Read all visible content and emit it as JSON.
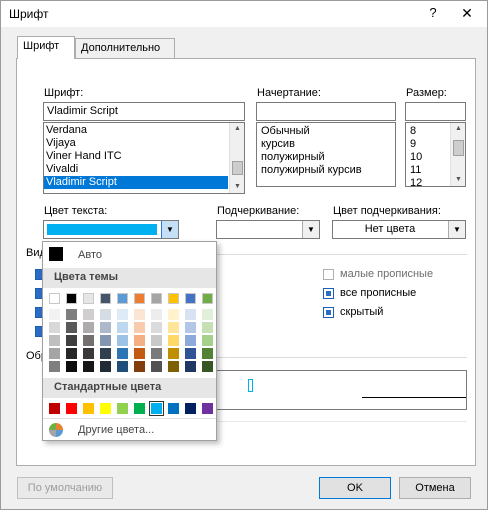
{
  "window": {
    "title": "Шрифт",
    "help": "?",
    "close": "✕"
  },
  "tabs": [
    {
      "label": "Шрифт",
      "active": true
    },
    {
      "label": "Дополнительно",
      "active": false
    }
  ],
  "font": {
    "label": "Шрифт:",
    "value": "Vladimir Script",
    "items": [
      "Verdana",
      "Vijaya",
      "Viner Hand ITC",
      "Vivaldi",
      "Vladimir Script"
    ],
    "selected_index": 4
  },
  "style": {
    "label": "Начертание:",
    "value": "",
    "items": [
      "Обычный",
      "курсив",
      "полужирный",
      "полужирный курсив"
    ]
  },
  "size": {
    "label": "Размер:",
    "value": "",
    "items": [
      "8",
      "9",
      "10",
      "11",
      "12"
    ]
  },
  "text_color": {
    "label": "Цвет текста:",
    "swatch": "#00b0f0"
  },
  "underline": {
    "label": "Подчеркивание:",
    "value": ""
  },
  "underline_color": {
    "label": "Цвет подчеркивания:",
    "value": "Нет цвета"
  },
  "effects": {
    "group_label": "Видоизменение",
    "items": [
      {
        "label": "малые прописные",
        "checked": false,
        "enabled": false
      },
      {
        "label": "все прописные",
        "checked": true,
        "enabled": true
      },
      {
        "label": "скрытый",
        "checked": true,
        "enabled": true
      }
    ]
  },
  "preview": {
    "label": "Образец"
  },
  "buttons": {
    "default": "По умолчанию",
    "ok": "OK",
    "cancel": "Отмена"
  },
  "color_popup": {
    "auto": "Авто",
    "theme_header": "Цвета темы",
    "theme_colors": [
      "#ffffff",
      "#000000",
      "#e7e6e6",
      "#44546a",
      "#5b9bd5",
      "#ed7d31",
      "#a5a5a5",
      "#ffc000",
      "#4472c4",
      "#70ad47"
    ],
    "theme_shades": [
      [
        "#f2f2f2",
        "#7f7f7f",
        "#d0cece",
        "#d6dce4",
        "#deeaf6",
        "#fbe5d5",
        "#ededed",
        "#fff2cc",
        "#d9e2f3",
        "#e2efd9"
      ],
      [
        "#d8d8d8",
        "#595959",
        "#aeabab",
        "#adb9ca",
        "#bdd7ee",
        "#f7cbac",
        "#dbdbdb",
        "#fee599",
        "#b4c6e7",
        "#c5e0b3"
      ],
      [
        "#bfbfbf",
        "#3f3f3f",
        "#757070",
        "#8496b0",
        "#9cc3e5",
        "#f4b083",
        "#c9c9c9",
        "#ffd965",
        "#8eaadb",
        "#a8d08d"
      ],
      [
        "#a5a5a5",
        "#262626",
        "#3a3838",
        "#323f4f",
        "#2e75b5",
        "#c45911",
        "#7b7b7b",
        "#bf8f00",
        "#2f5496",
        "#538135"
      ],
      [
        "#7f7f7f",
        "#0c0c0c",
        "#171616",
        "#222a35",
        "#1e4e79",
        "#833c0b",
        "#525252",
        "#7f6000",
        "#1f3763",
        "#375623"
      ]
    ],
    "standard_header": "Стандартные цвета",
    "standard_colors": [
      "#c00000",
      "#ff0000",
      "#ffc000",
      "#ffff00",
      "#92d050",
      "#00b050",
      "#00b0f0",
      "#0070c0",
      "#002060",
      "#7030a0"
    ],
    "standard_selected_index": 6,
    "more": "Другие цвета..."
  }
}
